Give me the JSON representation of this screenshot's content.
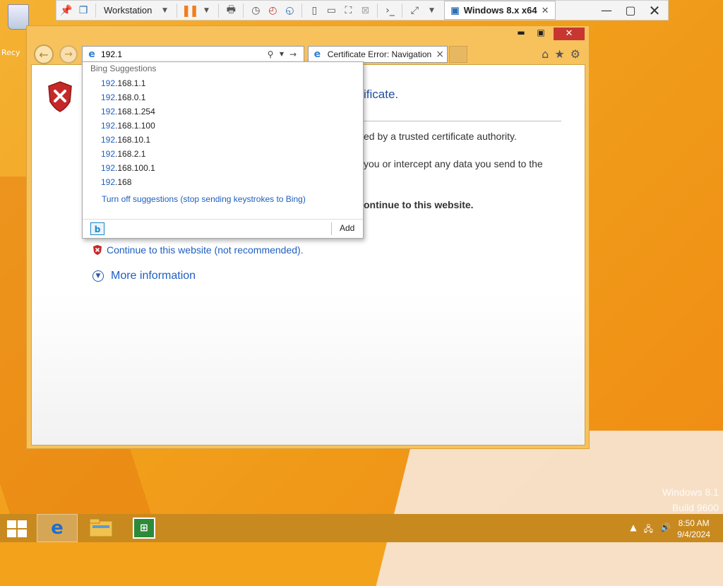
{
  "vmware": {
    "workstation_label": "Workstation",
    "vm_tab_label": "Windows 8.x x64",
    "icons": [
      "pin-icon",
      "vm-library-icon",
      "pause-icon",
      "send-ctrl-alt-del-icon",
      "snapshot-icon",
      "revert-snapshot-icon",
      "snapshot-manager-icon",
      "console-view-icon",
      "thumbnail-view-icon",
      "fit-window-icon",
      "unity-icon",
      "terminal-icon",
      "fullscreen-icon"
    ]
  },
  "desktop": {
    "recycle_bin_label": "Recy",
    "watermark_line1": "Windows 8.1",
    "watermark_line2": "Build 9600"
  },
  "ie": {
    "address_value": "192.1",
    "tab_title": "Certificate Error: Navigation...",
    "tab_close": "×",
    "cert_title_fragment": "ificate.",
    "desc_line1": "ed by a trusted certificate authority.",
    "desc_line2": "you or intercept any data you send to the",
    "desc_line3": "ontinue to this website.",
    "continue_link": "Continue to this website (not recommended).",
    "more_info_link": "More information"
  },
  "suggestions": {
    "header": "Bing Suggestions",
    "query": "192",
    "items": [
      {
        "match": "192",
        "rest": ".168.1.1"
      },
      {
        "match": "192",
        "rest": ".168.0.1"
      },
      {
        "match": "192",
        "rest": ".168.1.254"
      },
      {
        "match": "192",
        "rest": ".168.1.100"
      },
      {
        "match": "192",
        "rest": ".168.10.1"
      },
      {
        "match": "192",
        "rest": ".168.2.1"
      },
      {
        "match": "192",
        "rest": ".168.100.1"
      },
      {
        "match": "192",
        "rest": ".168"
      }
    ],
    "turn_off": "Turn off suggestions (stop sending keystrokes to Bing)",
    "bing_icon": "b",
    "add_label": "Add"
  },
  "taskbar": {
    "time": "8:50 AM",
    "date": "9/4/2024"
  },
  "colors": {
    "accent_orange": "#f19f1b",
    "link_blue": "#1f5fbf",
    "close_red": "#c7372f"
  }
}
